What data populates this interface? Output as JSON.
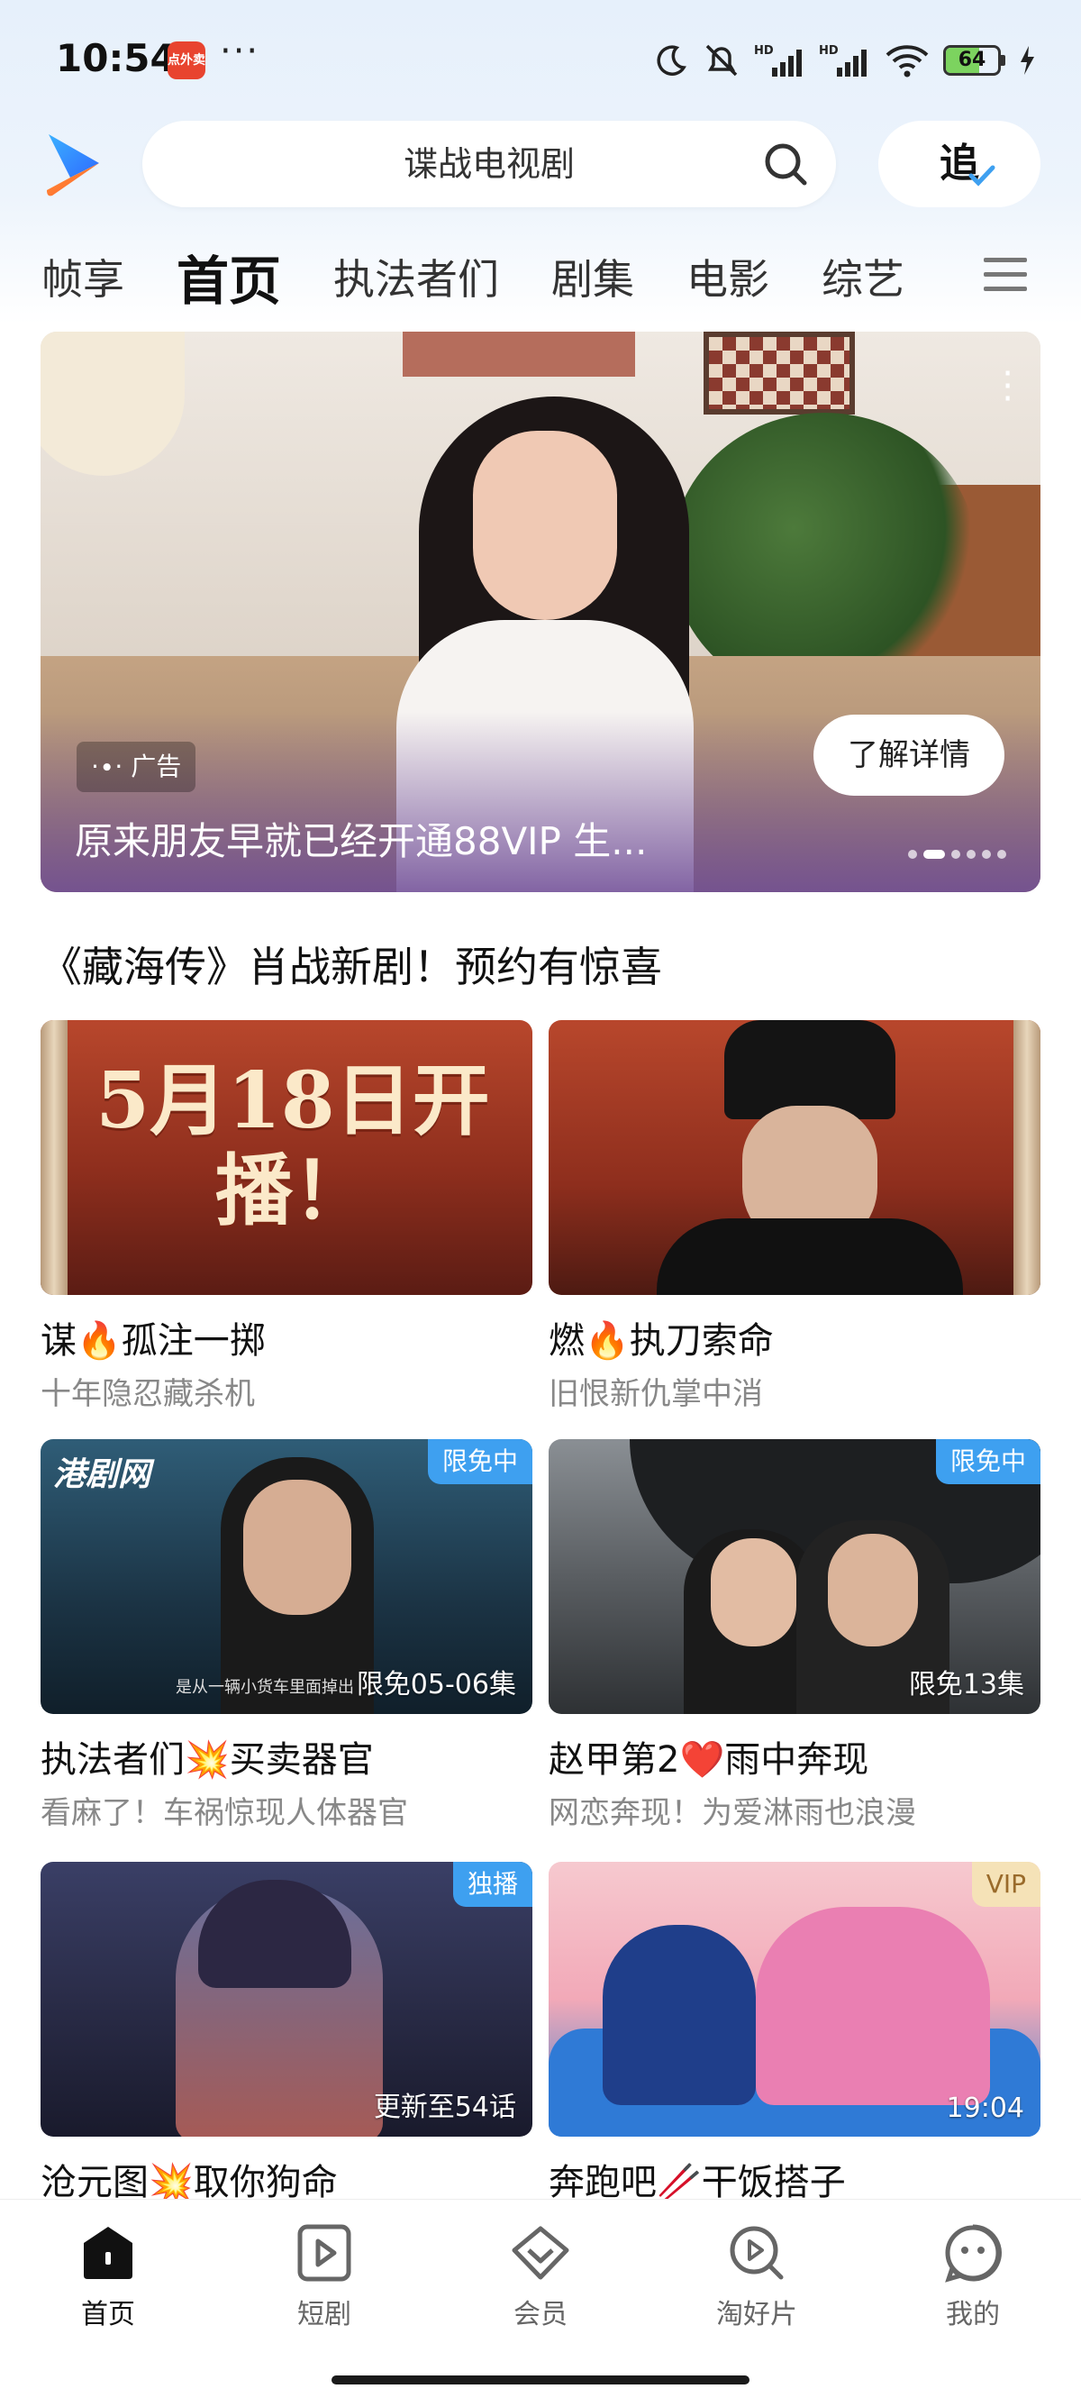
{
  "status_bar": {
    "time": "10:54",
    "app_badge": "点外卖",
    "more": "···",
    "battery": "64",
    "battery_level": 0.64,
    "icons": [
      "moon-icon",
      "bell-off-icon",
      "signal-hd-icon",
      "signal-hd-icon",
      "wifi-icon",
      "battery-icon",
      "charging-icon"
    ]
  },
  "header": {
    "search_text": "谍战电视剧",
    "follow_label": "追"
  },
  "tabs": [
    "帧享",
    "首页",
    "执法者们",
    "剧集",
    "电影",
    "综艺"
  ],
  "active_tab": "首页",
  "banner": {
    "ad_label": "广告",
    "cta": "了解详情",
    "title": "原来朋友早就已经开通88VIP 生...",
    "pages": 6,
    "active_page": 2
  },
  "section": {
    "title": "《藏海传》肖战新剧！预约有惊喜"
  },
  "cards": [
    {
      "poster_text": "5月18日开播！",
      "title": "谋🔥孤注一掷",
      "subtitle": "十年隐忍藏杀机",
      "badge": "",
      "episode": ""
    },
    {
      "poster_text": "",
      "title": "燃🔥执刀索命",
      "subtitle": "旧恨新仇掌中消",
      "badge": "",
      "episode": ""
    },
    {
      "poster_text": "港剧网",
      "title": "执法者们💥买卖器官",
      "subtitle": "看麻了！车祸惊现人体器官",
      "badge": "限免中",
      "episode": "限免05-06集",
      "caption": "是从一辆小货车里面掉出"
    },
    {
      "poster_text": "",
      "title": "赵甲第2❤️雨中奔现",
      "subtitle": "网恋奔现！为爱淋雨也浪漫",
      "badge": "限免中",
      "episode": "限免13集"
    },
    {
      "poster_text": "",
      "title": "沧元图💥取你狗命",
      "subtitle": "",
      "badge": "独播",
      "episode": "更新至54话"
    },
    {
      "poster_text": "",
      "title": "奔跑吧🥢干饭搭子",
      "subtitle": "",
      "badge": "VIP",
      "episode": "19:04"
    }
  ],
  "bottom_nav": [
    {
      "label": "首页",
      "icon": "home-icon"
    },
    {
      "label": "短剧",
      "icon": "short-drama-icon"
    },
    {
      "label": "会员",
      "icon": "vip-diamond-icon"
    },
    {
      "label": "淘好片",
      "icon": "discover-icon"
    },
    {
      "label": "我的",
      "icon": "profile-icon"
    }
  ],
  "colors": {
    "accent_blue": "#3ea0f0",
    "vip_gold": "#f5e2b7",
    "battery_green": "#7cd35f"
  }
}
